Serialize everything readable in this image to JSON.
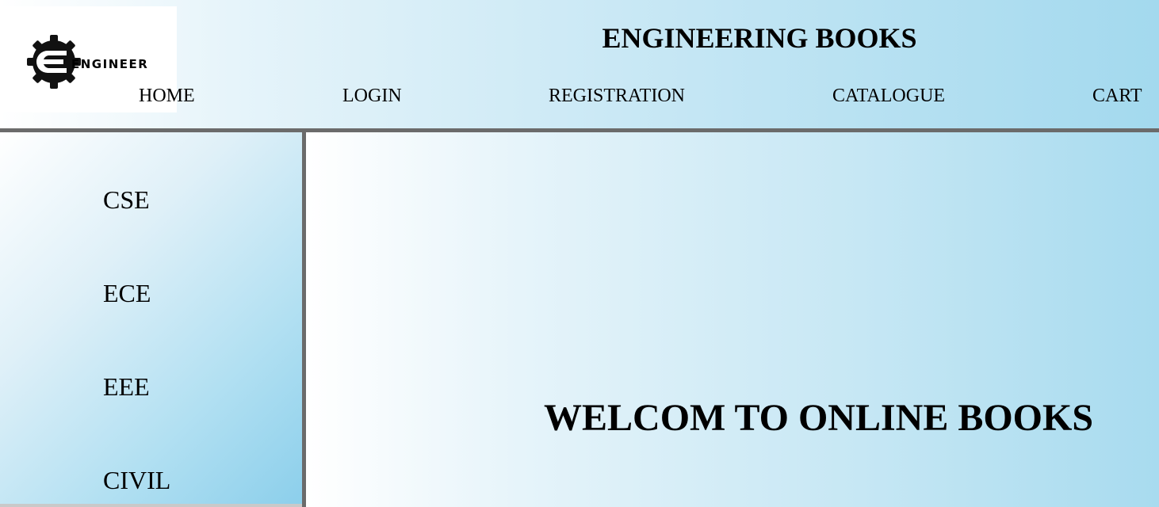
{
  "logo": {
    "icon": "gear-e-icon",
    "text": "ENGINEER"
  },
  "header": {
    "title": "ENGINEERING BOOKS"
  },
  "nav": {
    "home": "HOME",
    "login": "LOGIN",
    "registration": "REGISTRATION",
    "catalogue": "CATALOGUE",
    "cart": "CART"
  },
  "sidebar": {
    "items": [
      {
        "label": "CSE"
      },
      {
        "label": "ECE"
      },
      {
        "label": "EEE"
      },
      {
        "label": "CIVIL"
      }
    ]
  },
  "main": {
    "welcome": "WELCOM TO ONLINE BOOKS"
  },
  "colors": {
    "gradient_light": "#ffffff",
    "gradient_blue": "#a3d9ee",
    "divider": "#6b6b6b"
  }
}
